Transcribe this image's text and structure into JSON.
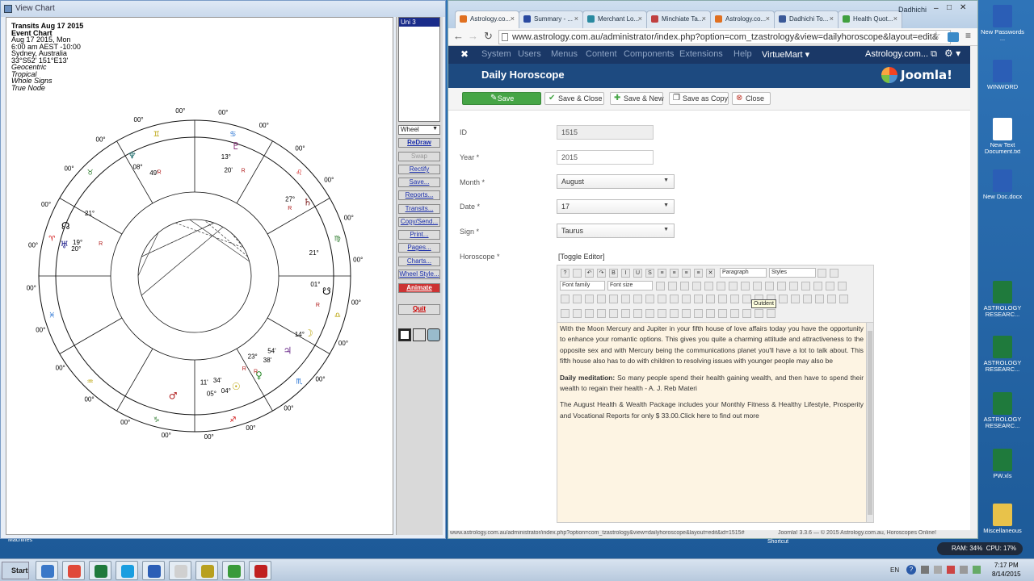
{
  "desktop": {
    "left_icon_label": "Machines",
    "icons": [
      {
        "label": "New Passwords ...",
        "icon": "word-doc-icon",
        "color": "#2b5eb6"
      },
      {
        "label": "WINWORD",
        "icon": "word-app-icon",
        "color": "#2b5eb6"
      },
      {
        "label": "New Text Document.txt",
        "icon": "text-file-icon",
        "color": "#ffffff"
      },
      {
        "label": "New Doc.docx",
        "icon": "word-doc-icon",
        "color": "#2b5eb6"
      },
      {
        "label": "ASTROLOGY RESEARC...",
        "icon": "excel-icon",
        "color": "#1f7a3c"
      },
      {
        "label": "ASTROLOGY RESEARC...",
        "icon": "excel-icon",
        "color": "#1f7a3c"
      },
      {
        "label": "ASTROLOGY RESEARC...",
        "icon": "excel-icon",
        "color": "#1f7a3c"
      },
      {
        "label": "PW.xls",
        "icon": "excel-icon",
        "color": "#1f7a3c"
      },
      {
        "label": "Miscellaneous",
        "icon": "folder-icon",
        "color": "#e8c24a"
      }
    ]
  },
  "chart_window": {
    "title": "View Chart",
    "header_lines": [
      "Transits Aug 17 2015",
      "Event Chart",
      "Aug 17 2015, Mon",
      "6:00 am  AEST -10:00",
      "Sydney, Australia",
      "33°S52' 151°E13'",
      "Geocentric",
      "Tropical",
      "Whole Signs",
      "True Node"
    ],
    "uni_list": [
      "Uni 3"
    ],
    "view_select": "Wheel",
    "buttons": [
      "ReDraw",
      "Swap",
      "Rectify",
      "Save...",
      "Reports...",
      "Transits...",
      "Copy/Send...",
      "Print...",
      "Pages...",
      "Charts...",
      "Wheel Style...",
      "Animate"
    ],
    "quit": "Quit",
    "cusp_labels": [
      "00°",
      "00°",
      "00°",
      "00°",
      "00°",
      "00°",
      "00°",
      "00°",
      "00°",
      "00°",
      "00°",
      "00°",
      "00°",
      "00°",
      "00°",
      "00°",
      "00°",
      "00°",
      "00°",
      "00°",
      "00°",
      "00°",
      "00°",
      "00°"
    ],
    "planet_labels": [
      "13°",
      "20'",
      "08°",
      "49'",
      "27°",
      "21°",
      "20°",
      "19°",
      "21°",
      "01°",
      "14°",
      "54'",
      "38'",
      "23°",
      "04°",
      "34'",
      "05°",
      "11'"
    ],
    "retro_mark": "R"
  },
  "browser": {
    "tabs": [
      {
        "label": "Astrology.co...",
        "active": true,
        "color": "#e07020"
      },
      {
        "label": "Summary - ...",
        "active": false,
        "color": "#2a4aa0"
      },
      {
        "label": "Merchant Lo...",
        "active": false,
        "color": "#2a8aa0"
      },
      {
        "label": "Minchiate Ta...",
        "active": false,
        "color": "#c04040"
      },
      {
        "label": "Astrology.co...",
        "active": false,
        "color": "#e07020"
      },
      {
        "label": "Dadhichi To...",
        "active": false,
        "color": "#3b5998"
      },
      {
        "label": "Health Quot...",
        "active": false,
        "color": "#40a040"
      }
    ],
    "tab_close": "×",
    "window_user": "Dadhichi",
    "url": "www.astrology.com.au/administrator/index.php?option=com_tzastrology&view=dailyhoroscope&layout=edit&",
    "joomla_menu": [
      "System",
      "Users",
      "Menus",
      "Content",
      "Components",
      "Extensions",
      "Help",
      "VirtueMart ▾"
    ],
    "site_link": "Astrology.com... ⧉",
    "page_title": "Daily Horoscope",
    "brand": "Joomla!",
    "toolbar": {
      "save": "Save",
      "save_close": "Save & Close",
      "save_new": "Save & New",
      "save_copy": "Save as Copy",
      "close": "Close"
    },
    "form": {
      "id_label": "ID",
      "id_value": "1515",
      "year_label": "Year *",
      "year_value": "2015",
      "month_label": "Month *",
      "month_value": "August",
      "date_label": "Date *",
      "date_value": "17",
      "sign_label": "Sign *",
      "sign_value": "Taurus",
      "horoscope_label": "Horoscope *",
      "toggle_editor": "[Toggle Editor]"
    },
    "editor": {
      "format_select": "Paragraph",
      "styles_select": "Styles",
      "font_family": "Font family",
      "font_size": "Font size",
      "tooltip": "Outdent",
      "para1": "With the Moon Mercury and Jupiter in your fifth house of love affairs today you have the opportunity to enhance your romantic options. This gives you quite a charming attitude and attractiveness to the opposite sex and with Mercury being the communications planet you'll have a lot to talk about. This fifth house also has to do with children to resolving issues with younger people may also be",
      "meditation_label": "Daily meditation:",
      "meditation_text": "  So many people spend their health gaining wealth, and then have to spend their wealth to regain their health - A. J. Reb Materi",
      "para3": "The August  Health & Wealth Package includes your Monthly Fitness & Healthy Lifestyle, Prosperity and Vocational Reports  for only $ 33.00.Click here to find out more"
    },
    "status_url": "www.astrology.com.au/administrator/index.php?option=com_tzastrology&view=dailyhoroscope&layout=edit&id=1515#",
    "footer": "Joomla! 3.3.6  —  © 2015 Astrology.com.au, Horoscopes Online!"
  },
  "taskbar": {
    "start": "Start",
    "apps": [
      {
        "name": "ie-icon",
        "color": "#3a78c8"
      },
      {
        "name": "chrome-icon",
        "color": "#e04a3a"
      },
      {
        "name": "excel-icon",
        "color": "#1f7a3c"
      },
      {
        "name": "skype-icon",
        "color": "#1a9ee0"
      },
      {
        "name": "word-icon",
        "color": "#2b5eb6"
      },
      {
        "name": "app-icon",
        "color": "#d0d0d0"
      },
      {
        "name": "astro-icon",
        "color": "#b8a020"
      },
      {
        "name": "notepad-icon",
        "color": "#3a9a3a"
      },
      {
        "name": "recorder-icon",
        "color": "#c02020"
      }
    ],
    "lang": "EN",
    "time": "7:17 PM",
    "date": "8/14/2015",
    "ram": "RAM: 34%",
    "cpu": "CPU: 17%",
    "shortcut_label": "Shortcut"
  }
}
